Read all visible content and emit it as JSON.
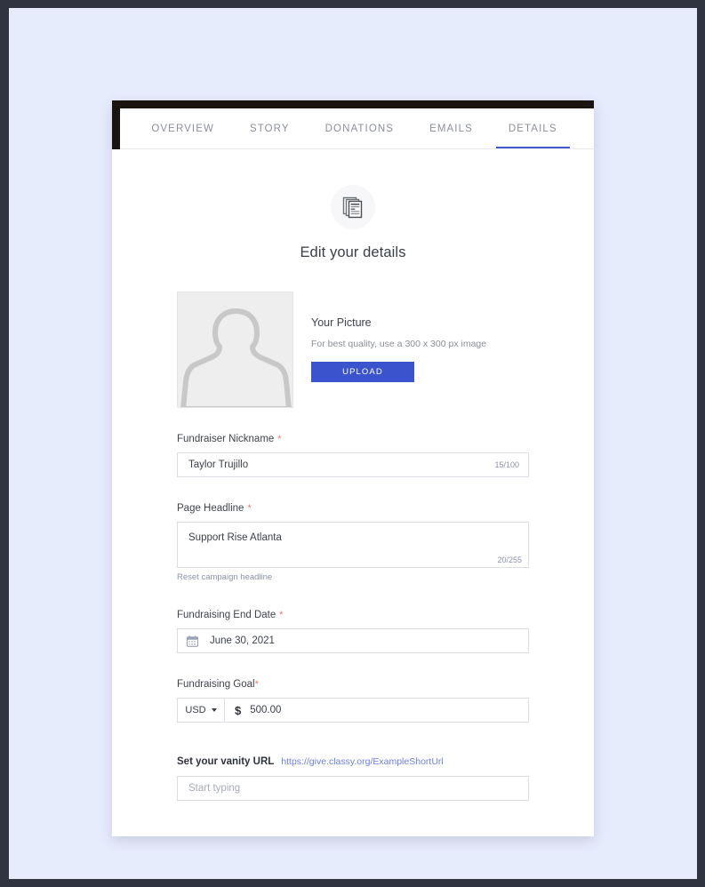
{
  "theme": {
    "frame_color": "#2f3440",
    "page_background": "#e7ecfd",
    "card_background": "#ffffff",
    "accent_blue": "#3b53cd",
    "tab_underline": "#3e57cd",
    "required_star": "#f3776a",
    "link_blue": "#6c7fe0",
    "muted_text": "#8b8f98"
  },
  "tabs": [
    {
      "label": "OVERVIEW",
      "active": false
    },
    {
      "label": "STORY",
      "active": false
    },
    {
      "label": "DONATIONS",
      "active": false
    },
    {
      "label": "EMAILS",
      "active": false
    },
    {
      "label": "DETAILS",
      "active": true
    }
  ],
  "header": {
    "icon": "documents-icon",
    "title": "Edit your details"
  },
  "picture": {
    "avatar_icon": "person-silhouette-icon",
    "label": "Your Picture",
    "hint": "For best quality, use a 300 x 300 px image",
    "upload_label": "UPLOAD"
  },
  "fields": {
    "nickname": {
      "label": "Fundraiser Nickname",
      "required_marker": "*",
      "value": "Taylor Trujillo",
      "placeholder": "",
      "counter": "15/100"
    },
    "headline": {
      "label": "Page Headline",
      "required_marker": "*",
      "value": "Support Rise Atlanta",
      "placeholder": "",
      "counter": "20/255",
      "reset_link": "Reset campaign headline"
    },
    "end_date": {
      "label": "Fundraising End Date",
      "required_marker": "*",
      "icon": "calendar-icon",
      "value": "June 30, 2021"
    },
    "goal": {
      "label": "Fundraising Goal",
      "required_marker": "*",
      "currency": "USD",
      "currency_symbol": "$",
      "amount": "500.00"
    },
    "vanity_url": {
      "label": "Set your vanity URL",
      "example_url": "https://give.classy.org/ExampleShortUrl",
      "value": "",
      "placeholder": "Start typing"
    }
  }
}
